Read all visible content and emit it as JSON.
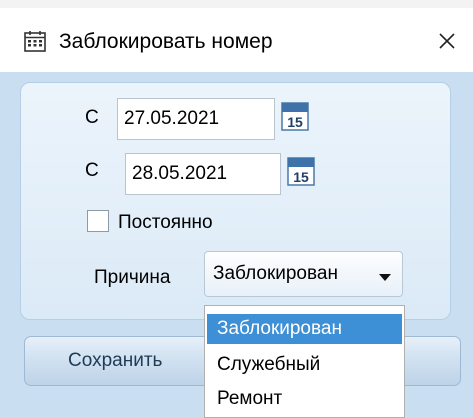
{
  "window": {
    "title": "Заблокировать номер",
    "icon": "calendar-icon",
    "close_icon": "close-icon"
  },
  "form": {
    "from_label": "С",
    "from_date": "27.05.2021",
    "to_label": "С",
    "to_date": "28.05.2021",
    "calendar_day": "15",
    "permanent_label": "Постоянно",
    "permanent_checked": false,
    "reason_label": "Причина",
    "reason_value": "Заблокирован",
    "save_label": "Сохранить"
  },
  "dropdown": {
    "options": [
      "Заблокирован",
      "Служебный",
      "Ремонт"
    ],
    "selected_index": 0
  },
  "colors": {
    "accent": "#3d8fd6",
    "panel_background": "#c9def0"
  }
}
